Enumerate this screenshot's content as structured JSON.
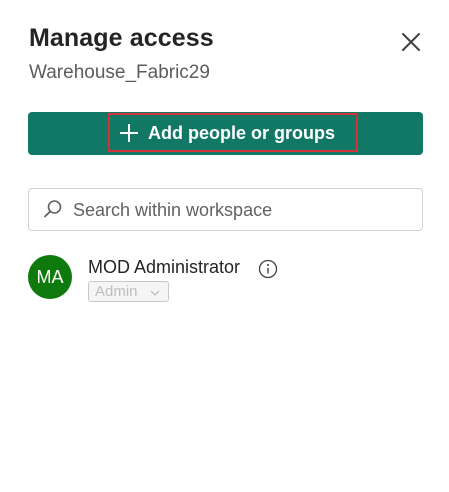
{
  "dialog": {
    "title": "Manage access",
    "subtitle": "Warehouse_Fabric29",
    "close_icon": "close-icon"
  },
  "add_button": {
    "label": "Add people or groups",
    "icon": "plus-icon",
    "background": "#117865",
    "highlight_color": "#d13438"
  },
  "search": {
    "placeholder": "Search within workspace",
    "icon": "search-icon"
  },
  "members": [
    {
      "initials": "MA",
      "name": "MOD Administrator",
      "role": "Admin",
      "avatar_color": "#0e7a0d",
      "info_icon": "info-icon",
      "role_disabled": true
    }
  ]
}
